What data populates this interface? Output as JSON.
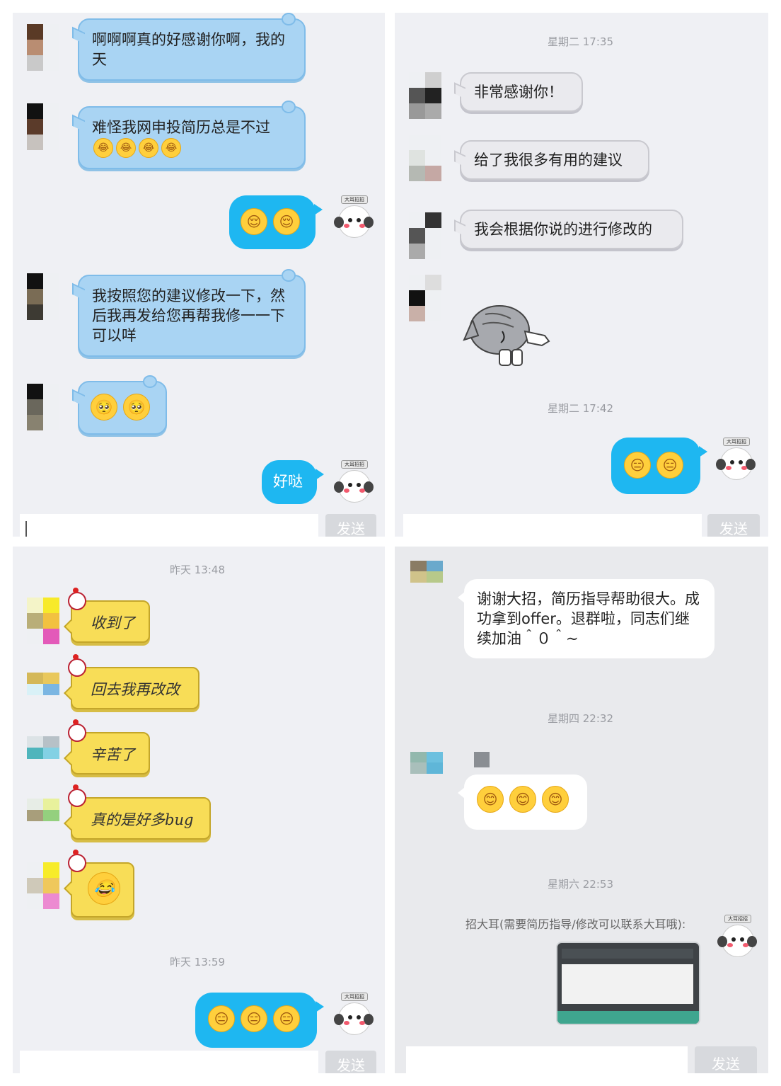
{
  "panel1": {
    "msg1": "啊啊啊真的好感谢你啊，我的天",
    "msg2": "难怪我网申投简历总是不过",
    "msg2_emojis": [
      "😂",
      "😂",
      "😂",
      "😂"
    ],
    "sent1_emojis": [
      "😌",
      "😌"
    ],
    "msg3": "我按照您的建议修改一下，然后我再发给您再帮我修一一下可以咩",
    "msg4_emojis": [
      "🥺",
      "🥺"
    ],
    "sent2": "好哒",
    "send": "发送"
  },
  "panel2": {
    "time1": "星期二 17:35",
    "msg1": "非常感谢你！",
    "msg2": "给了我很多有用的建议",
    "msg3": "我会根据你说的进行修改的",
    "sticker": "cat-bowing-sticker",
    "time2": "星期二 17:42",
    "sent_emojis": [
      "😑",
      "😑"
    ],
    "send": "发送"
  },
  "panel3": {
    "time1": "昨天 13:48",
    "msg1": "收到了",
    "msg2": "回去我再改改",
    "msg3": "辛苦了",
    "msg4": "真的是好多bug",
    "msg5_emoji": "😂",
    "time2": "昨天 13:59",
    "sent_emojis": [
      "😑",
      "😑",
      "😑"
    ],
    "send": "发送"
  },
  "panel4": {
    "msg1": "谢谢大招，简历指导帮助很大。成功拿到offer。退群啦，同志们继续加油＾０＾~",
    "time1": "星期四 22:32",
    "msg2_emojis": [
      "😊",
      "😊",
      "😊"
    ],
    "time2": "星期六 22:53",
    "sender_name": "招大耳(需要简历指导/修改可以联系大耳哦):",
    "image": "table-screenshot-thumbnail",
    "send": "发送"
  },
  "mascot_tag": "大耳招招",
  "colors": {
    "panel_bg": "#eff0f4",
    "blue_bubble": "#a9d4f3",
    "sent_bubble": "#1eb7f1",
    "yellow_bubble": "#f8dd57",
    "timestamp": "#9a9ca2"
  }
}
